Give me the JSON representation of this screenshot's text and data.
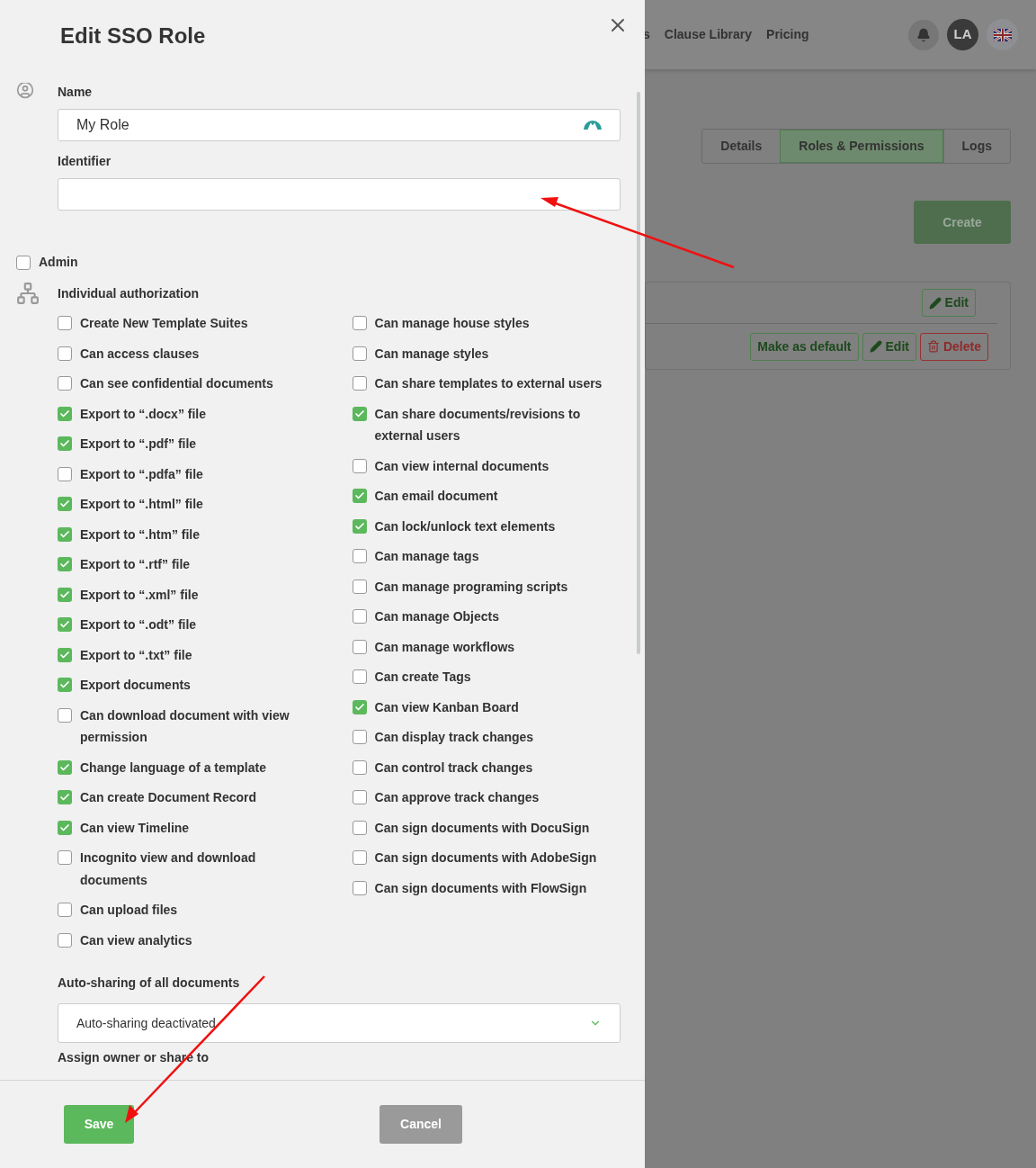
{
  "dialog": {
    "title": "Edit SSO Role",
    "fields": [
      {
        "label": "Name",
        "value": "My Role"
      },
      {
        "label": "Identifier"
      }
    ],
    "admin": {
      "label": "Admin",
      "checked": false
    },
    "section_title": "Individual authorization",
    "permissions": {
      "column_1": [
        {
          "label": "Create New Template Suites",
          "checked": false
        },
        {
          "label": "Can access clauses",
          "checked": false
        },
        {
          "label": "Can see confidential documents",
          "checked": false
        },
        {
          "label": "Export to “.docx” file",
          "checked": true
        },
        {
          "label": "Export to “.pdf” file",
          "checked": true
        },
        {
          "label": "Export to “.pdfa” file",
          "checked": false
        },
        {
          "label": "Export to “.html” file",
          "checked": true
        },
        {
          "label": "Export to “.htm” file",
          "checked": true
        },
        {
          "label": "Export to “.rtf” file",
          "checked": true
        },
        {
          "label": "Export to “.xml” file",
          "checked": true
        },
        {
          "label": "Export to “.odt” file",
          "checked": true
        },
        {
          "label": "Export to “.txt” file",
          "checked": true
        },
        {
          "label": "Export documents",
          "checked": true
        },
        {
          "label": "Can download document with view permission",
          "checked": false
        },
        {
          "label": "Change language of a template",
          "checked": true
        },
        {
          "label": "Can create Document Record",
          "checked": true
        },
        {
          "label": "Can view Timeline",
          "checked": true
        },
        {
          "label": "Incognito view and download documents",
          "checked": false
        },
        {
          "label": "Can upload files",
          "checked": false
        },
        {
          "label": "Can view analytics",
          "checked": false
        }
      ],
      "column_2": [
        {
          "label": "Can manage house styles",
          "checked": false
        },
        {
          "label": "Can manage styles",
          "checked": false
        },
        {
          "label": "Can share templates to external users",
          "checked": false
        },
        {
          "label": "Can share documents/revisions to external users",
          "checked": true
        },
        {
          "label": "Can view internal documents",
          "checked": false
        },
        {
          "label": "Can email document",
          "checked": true
        },
        {
          "label": "Can lock/unlock text elements",
          "checked": true
        },
        {
          "label": "Can manage tags",
          "checked": false
        },
        {
          "label": "Can manage programing scripts",
          "checked": false
        },
        {
          "label": "Can manage Objects",
          "checked": false
        },
        {
          "label": "Can manage workflows",
          "checked": false
        },
        {
          "label": "Can create Tags",
          "checked": false
        },
        {
          "label": "Can view Kanban Board",
          "checked": true
        },
        {
          "label": "Can display track changes",
          "checked": false
        },
        {
          "label": "Can control track changes",
          "checked": false
        },
        {
          "label": "Can approve track changes",
          "checked": false
        },
        {
          "label": "Can sign documents with DocuSign",
          "checked": false
        },
        {
          "label": "Can sign documents with AdobeSign",
          "checked": false
        },
        {
          "label": "Can sign documents with FlowSign",
          "checked": false
        }
      ]
    },
    "auto_sharing": {
      "label": "Auto-sharing of all documents",
      "value": "Auto-sharing deactivated"
    },
    "next_label": "Assign owner or share to",
    "buttons": [
      {
        "label": "Save",
        "kind": "primary"
      },
      {
        "label": "Cancel",
        "kind": "secondary"
      }
    ]
  },
  "background": {
    "nav_links": [
      "s",
      "Clause Library",
      "Pricing"
    ],
    "avatar": "LA",
    "tabs": [
      {
        "label": "Details",
        "selected": false
      },
      {
        "label": "Roles & Permissions",
        "selected": true
      },
      {
        "label": "Logs",
        "selected": false
      }
    ],
    "create_button": "Create",
    "card": {
      "header_buttons": [
        {
          "label": "Edit",
          "kind": "edit"
        }
      ],
      "row_buttons": [
        {
          "label": "Make as default",
          "kind": "plain"
        },
        {
          "label": "Edit",
          "kind": "edit"
        },
        {
          "label": "Delete",
          "kind": "delete"
        }
      ]
    }
  }
}
